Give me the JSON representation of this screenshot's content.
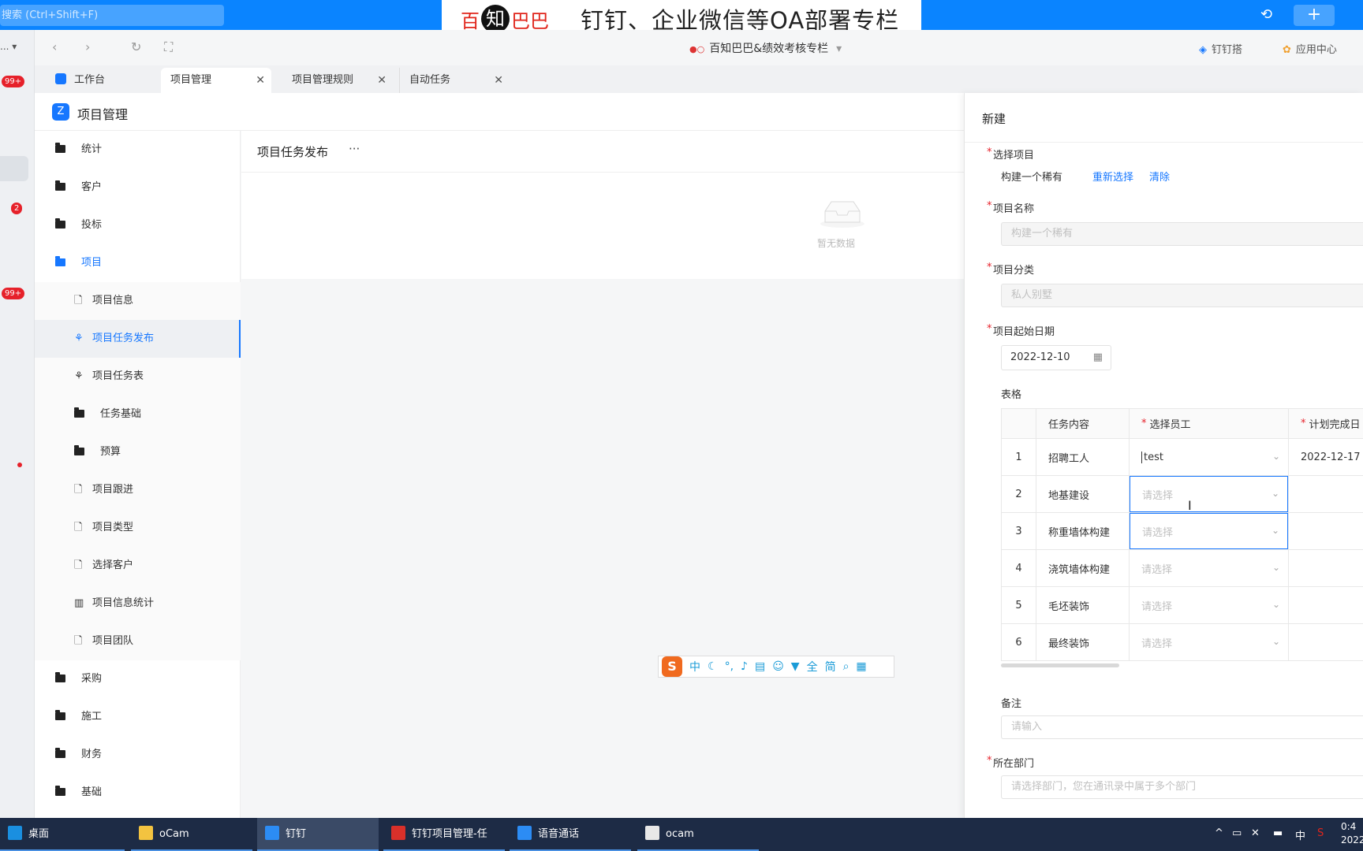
{
  "topbar": {
    "search_placeholder": "搜索 (Ctrl+Shift+F)",
    "banner_brand_1": "百",
    "banner_brand_2": "知",
    "banner_brand_3": "巴巴",
    "banner_slogan": "钉钉、企业微信等OA部署专栏",
    "plus": "+"
  },
  "leftstrip": {
    "badges": [
      "99+",
      "2",
      "99+"
    ],
    "more": "... ▾"
  },
  "navbar": {
    "org_name": "百知巴巴&绩效考核专栏",
    "right_links": [
      "钉钉搭",
      "应用中心"
    ]
  },
  "tabs": [
    {
      "label": "工作台"
    },
    {
      "label": "项目管理"
    },
    {
      "label": "项目管理规则"
    },
    {
      "label": "自动任务"
    }
  ],
  "app": {
    "title": "项目管理",
    "logo": "Z"
  },
  "menu": [
    {
      "label": "统计"
    },
    {
      "label": "客户"
    },
    {
      "label": "投标"
    },
    {
      "label": "项目"
    },
    {
      "label": "项目信息"
    },
    {
      "label": "项目任务发布"
    },
    {
      "label": "项目任务表"
    },
    {
      "label": "任务基础"
    },
    {
      "label": "预算"
    },
    {
      "label": "项目跟进"
    },
    {
      "label": "项目类型"
    },
    {
      "label": "选择客户"
    },
    {
      "label": "项目信息统计"
    },
    {
      "label": "项目团队"
    },
    {
      "label": "采购"
    },
    {
      "label": "施工"
    },
    {
      "label": "财务"
    },
    {
      "label": "基础"
    }
  ],
  "content": {
    "title": "项目任务发布",
    "more": "···",
    "empty": "暂无数据"
  },
  "ime": {
    "logo": "S",
    "keys": [
      "中",
      "☾",
      "°,",
      "🎤",
      "⌨",
      "👤",
      "👕",
      "全",
      "简",
      "🔍",
      "▦"
    ]
  },
  "drawer": {
    "title": "新建",
    "select_project_label": "选择项目",
    "select_project_value": "构建一个稀有",
    "reselect": "重新选择",
    "clear": "清除",
    "project_name_label": "项目名称",
    "project_name_value": "构建一个稀有",
    "project_category_label": "项目分类",
    "project_category_value": "私人别墅",
    "start_date_label": "项目起始日期",
    "start_date_value": "2022-12-10",
    "table_label": "表格",
    "table": {
      "headers": [
        "",
        "任务内容",
        "选择员工",
        "计划完成日"
      ],
      "placeholder": "请选择",
      "rows": [
        {
          "no": "1",
          "task": "招聘工人",
          "employee": "test",
          "date": "2022-12-17"
        },
        {
          "no": "2",
          "task": "地基建设",
          "employee": "",
          "date": ""
        },
        {
          "no": "3",
          "task": "称重墙体构建",
          "employee": "",
          "date": ""
        },
        {
          "no": "4",
          "task": "浇筑墙体构建",
          "employee": "",
          "date": ""
        },
        {
          "no": "5",
          "task": "毛坯装饰",
          "employee": "",
          "date": ""
        },
        {
          "no": "6",
          "task": "最终装饰",
          "employee": "",
          "date": ""
        }
      ]
    },
    "remark_label": "备注",
    "remark_placeholder": "请输入",
    "department_label": "所在部门",
    "department_placeholder": "请选择部门，您在通讯录中属于多个部门"
  },
  "taskbar": {
    "items": [
      "桌面",
      "oCam",
      "钉钉",
      "钉钉项目管理-任务...",
      "语音通话",
      "ocam"
    ],
    "tray": [
      "^",
      "中"
    ],
    "clock_time": "0:4",
    "clock_date": "2022"
  },
  "colors": {
    "accent": "#1677ff",
    "topbar": "#0a84ff",
    "required": "#e6212a",
    "taskbar": "#1d2b45"
  }
}
